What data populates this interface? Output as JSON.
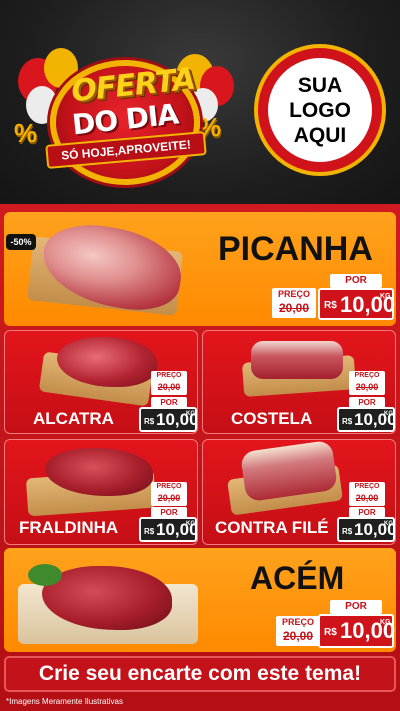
{
  "header": {
    "offer_line1": "OFERTA",
    "offer_line2": "DO DIA",
    "offer_ribbon": "SÓ HOJE,APROVEITE!",
    "percent_symbol": "%",
    "logo_lines": [
      "SUA",
      "LOGO",
      "AQUI"
    ]
  },
  "products": [
    {
      "name": "PICANHA",
      "badge": "-50%",
      "old_label": "PREÇO",
      "old_price": "20,00",
      "por": "POR",
      "currency": "R$",
      "price": "10,00",
      "unit": "KG"
    },
    {
      "name": "ALCATRA",
      "old_label": "PREÇO",
      "old_price": "20,00",
      "por": "POR",
      "currency": "R$",
      "price": "10,00",
      "unit": "KG"
    },
    {
      "name": "COSTELA",
      "old_label": "PREÇO",
      "old_price": "20,00",
      "por": "POR",
      "currency": "R$",
      "price": "10,00",
      "unit": "KG"
    },
    {
      "name": "FRALDINHA",
      "old_label": "PREÇO",
      "old_price": "20,00",
      "por": "POR",
      "currency": "R$",
      "price": "10,00",
      "unit": "KG"
    },
    {
      "name": "CONTRA FILÉ",
      "old_label": "PREÇO",
      "old_price": "20,00",
      "por": "POR",
      "currency": "R$",
      "price": "10,00",
      "unit": "KG"
    },
    {
      "name": "ACÉM",
      "old_label": "PREÇO",
      "old_price": "20,00",
      "por": "POR",
      "currency": "R$",
      "price": "10,00",
      "unit": "KG"
    }
  ],
  "footer": {
    "cta": "Crie seu encarte com este tema!",
    "disclaimer": "*Imagens Meramente Ilustrativas"
  },
  "colors": {
    "red": "#d0121b",
    "orange": "#ff9a10",
    "gold": "#f2b400",
    "dark": "#1c1c1c"
  }
}
